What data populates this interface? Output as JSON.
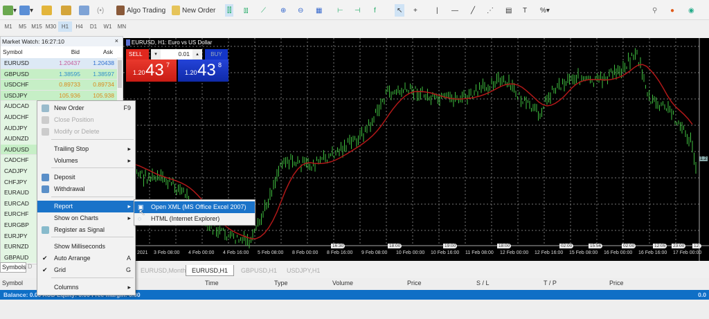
{
  "toolbar": {
    "algo_trading": "Algo Trading",
    "new_order": "New Order"
  },
  "timeframes": [
    "M1",
    "M5",
    "M15",
    "M30",
    "H1",
    "H4",
    "D1",
    "W1",
    "MN"
  ],
  "market_watch": {
    "title": "Market Watch: 16:27:10",
    "col_symbol": "Symbol",
    "col_bid": "Bid",
    "col_ask": "Ask",
    "rows": [
      {
        "symbol": "EURUSD",
        "bid": "1.20437",
        "ask": "1.20438"
      },
      {
        "symbol": "GBPUSD",
        "bid": "1.38595",
        "ask": "1.38597"
      },
      {
        "symbol": "USDCHF",
        "bid": "0.89733",
        "ask": "0.89734"
      },
      {
        "symbol": "USDJPY",
        "bid": "105.936",
        "ask": "105.938"
      },
      {
        "symbol": "AUDCAD"
      },
      {
        "symbol": "AUDCHF"
      },
      {
        "symbol": "AUDJPY"
      },
      {
        "symbol": "AUDNZD"
      },
      {
        "symbol": "AUDUSD"
      },
      {
        "symbol": "CADCHF"
      },
      {
        "symbol": "CADJPY"
      },
      {
        "symbol": "CHFJPY"
      },
      {
        "symbol": "EURAUD"
      },
      {
        "symbol": "EURCAD"
      },
      {
        "symbol": "EURCHF"
      },
      {
        "symbol": "EURGBP"
      },
      {
        "symbol": "EURJPY"
      },
      {
        "symbol": "EURNZD"
      },
      {
        "symbol": "GBPAUD"
      }
    ],
    "tab_symbols": "Symbols",
    "tab_details": "D"
  },
  "chart": {
    "title": "EURUSD, H1: Euro vs US Dollar",
    "sell": "SELL",
    "buy": "BUY",
    "lot": "0.01",
    "sell_prefix": "1.20",
    "sell_big": "43",
    "sell_sup": "7",
    "buy_prefix": "1.20",
    "buy_big": "43",
    "buy_sup": "8",
    "time_labels": [
      "2021",
      "3 Feb 08:00",
      "4 Feb 00:00",
      "4 Feb 16:00",
      "5 Feb 08:00",
      "8 Feb 00:00",
      "8 Feb 16:00",
      "9 Feb 08:00",
      "10 Feb 00:00",
      "10 Feb 16:00",
      "11 Feb 08:00",
      "12 Feb 00:00",
      "12 Feb 16:00",
      "15 Feb 08:00",
      "16 Feb 00:00",
      "16 Feb 16:00",
      "17 Feb 00:00"
    ],
    "price_label": "1.2",
    "event_labels": [
      "16:30",
      "18:00",
      "19:00",
      "18:00",
      "02:00",
      "15:56",
      "02:00",
      "12:05",
      "23:00",
      "12:"
    ]
  },
  "chart_tabs": [
    "EURUSD,Monthly",
    "EURUSD,H1",
    "GBPUSD,H1",
    "USDJPY,H1"
  ],
  "menu": [
    {
      "label": "New Order",
      "shortcut": "F9",
      "icon": "new-order-icon"
    },
    {
      "label": "Close Position",
      "disabled": true,
      "icon": "close-position-icon"
    },
    {
      "label": "Modify or Delete",
      "disabled": true,
      "icon": "modify-icon"
    },
    {
      "label": "Trailing Stop",
      "submenu": true
    },
    {
      "label": "Volumes",
      "submenu": true
    },
    {
      "label": "Deposit",
      "icon": "deposit-icon"
    },
    {
      "label": "Withdrawal",
      "icon": "withdrawal-icon"
    },
    {
      "label": "Report",
      "submenu": true,
      "highlighted": true
    },
    {
      "label": "Show on Charts",
      "submenu": true
    },
    {
      "label": "Register as Signal",
      "icon": "signal-icon"
    },
    {
      "label": "Show Milliseconds"
    },
    {
      "label": "Auto Arrange",
      "shortcut": "A",
      "checked": true
    },
    {
      "label": "Grid",
      "shortcut": "G",
      "checked": true
    },
    {
      "label": "Columns",
      "submenu": true
    }
  ],
  "submenu": [
    "Open XML (MS Office Excel 2007)",
    "HTML (Internet Explorer)"
  ],
  "terminal": {
    "headers": [
      "Symbol",
      "Time",
      "Type",
      "Volume",
      "Price",
      "S / L",
      "T / P",
      "Price"
    ],
    "balance": "Balance: 0.00 AUD  Equity: 0.00  Free margin: 0.00",
    "right_value": "0.0"
  },
  "colors": {
    "chart_bg": "#000000",
    "bars": "#3fbf3f",
    "ma": "#b01818",
    "sell": "#e0281e",
    "buy": "#1436c8",
    "highlight": "#1a73c9"
  }
}
